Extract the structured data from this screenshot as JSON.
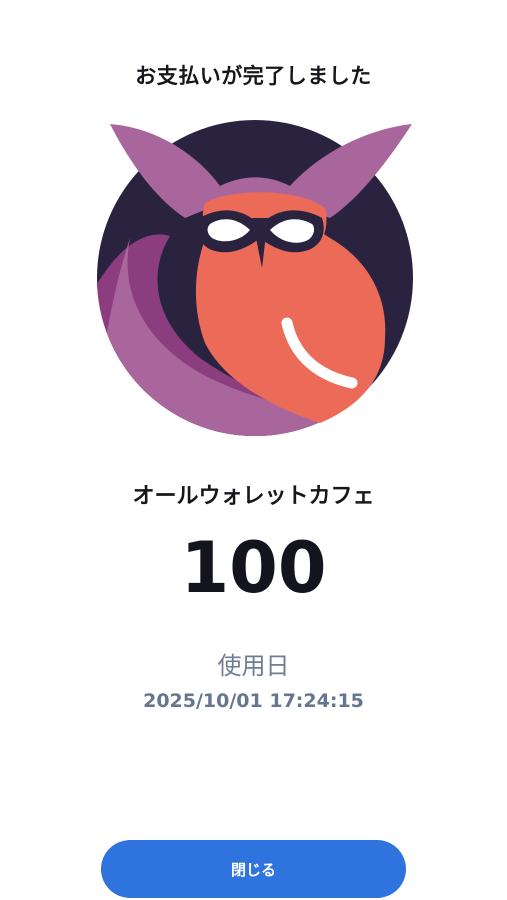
{
  "header": {
    "title": "お支払いが完了しました"
  },
  "logo": {
    "icon": "owl-icon",
    "colors": {
      "circle": "#2a2340",
      "wing": "#a8669c",
      "wing_dark": "#8c3d80",
      "body": "#ec6b58",
      "eye_white": "#ffffff"
    }
  },
  "merchant": {
    "name": "オールウォレットカフェ"
  },
  "payment": {
    "amount": "100",
    "usage_label": "使用日",
    "usage_datetime": "2025/10/01 17:24:15"
  },
  "actions": {
    "close_label": "閉じる",
    "close_color": "#2f74de"
  }
}
